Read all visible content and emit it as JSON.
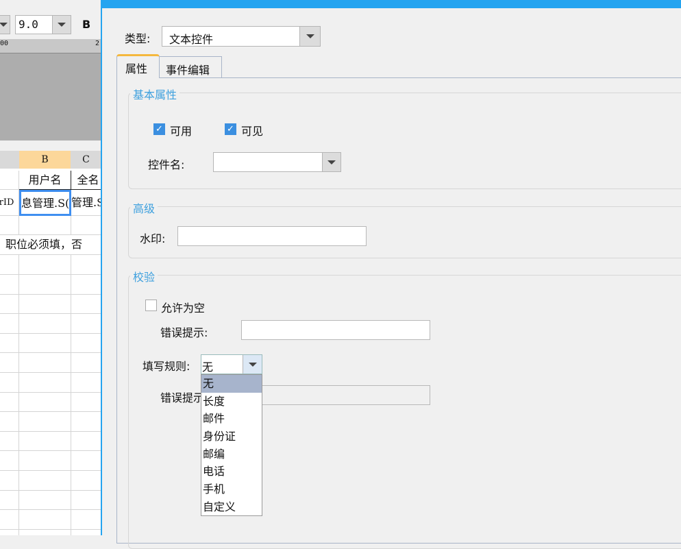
{
  "left": {
    "font_size": "9.0",
    "bold_label": "B",
    "ruler_ticks": [
      "00",
      "2"
    ],
    "columns": [
      "B",
      "C"
    ],
    "cells": {
      "r1": [
        "用户名",
        "全名"
      ],
      "r2": [
        "rID",
        "息管理.S(",
        "管理.S"
      ],
      "r4": "、职位必须填，否"
    }
  },
  "dialog": {
    "type_label": "类型:",
    "type_value": "文本控件",
    "tabs": [
      {
        "label": "属性",
        "active": true
      },
      {
        "label": "事件编辑",
        "active": false
      }
    ],
    "basic": {
      "legend": "基本属性",
      "enabled": {
        "label": "可用",
        "checked": true
      },
      "visible": {
        "label": "可见",
        "checked": true
      },
      "name_label": "控件名:",
      "name_value": ""
    },
    "advanced": {
      "legend": "高级",
      "watermark_label": "水印:",
      "watermark_value": ""
    },
    "validation": {
      "legend": "校验",
      "allow_empty": {
        "label": "允许为空",
        "checked": false
      },
      "error_label": "错误提示:",
      "error_value": "",
      "rule_label": "填写规则:",
      "rule_value": "无",
      "error2_label": "错误提示:",
      "options": [
        "无",
        "长度",
        "邮件",
        "身份证",
        "邮编",
        "电话",
        "手机",
        "自定义"
      ]
    }
  },
  "colors": {
    "accent": "#25a4f0",
    "selected_col": "#fcd79a",
    "highlight": "#a7b4cc"
  }
}
